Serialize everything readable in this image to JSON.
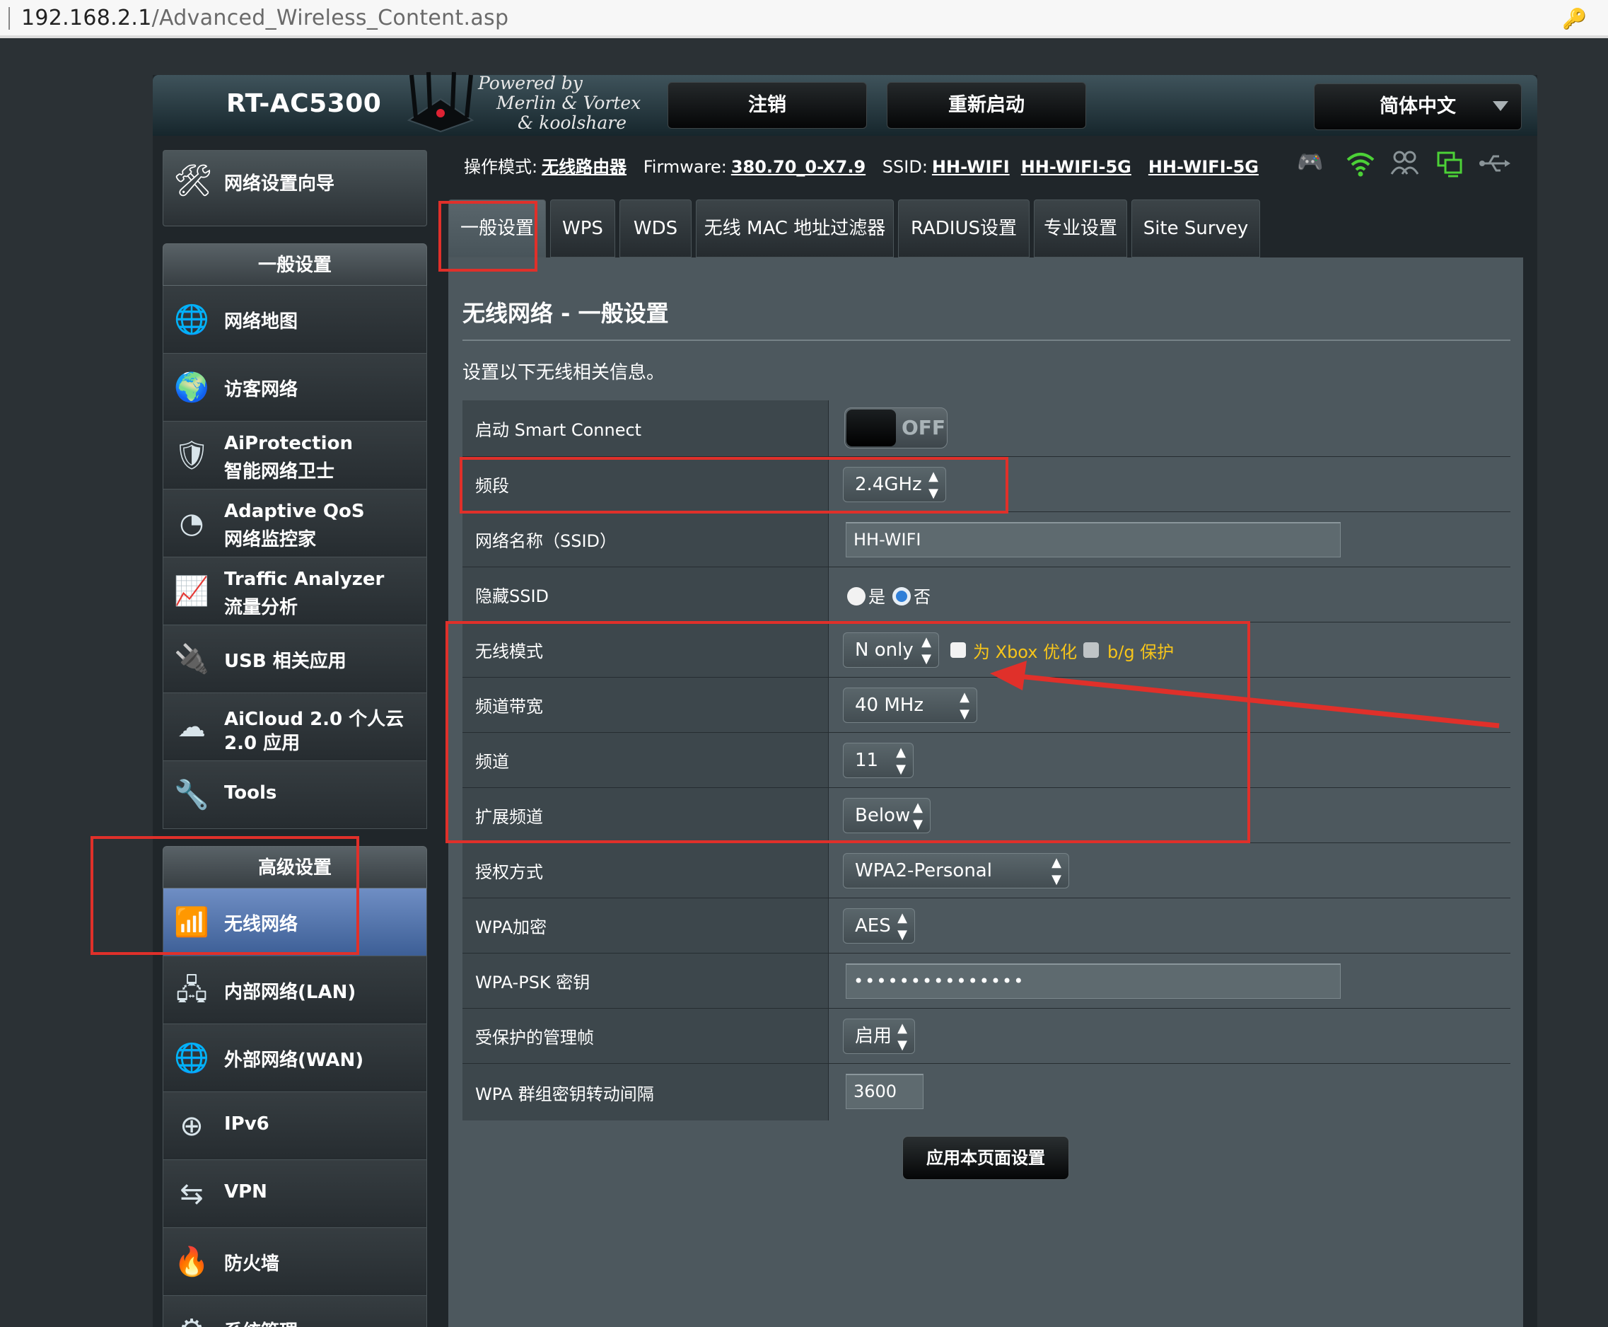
{
  "browser": {
    "url_host": "192.168.2.1",
    "url_path": "/Advanced_Wireless_Content.asp",
    "key_icon": "key-icon"
  },
  "header": {
    "model": "RT-AC5300",
    "powered": [
      "Powered by",
      "Merlin & Vortex",
      "& koolshare"
    ],
    "logout": "注销",
    "reboot": "重新启动",
    "language": "简体中文"
  },
  "status": {
    "mode_label": "操作模式:",
    "mode": "无线路由器",
    "fw_label": "Firmware:",
    "fw": "380.70_0-X7.9",
    "ssid_label": "SSID:",
    "ssid1": "HH-WIFI",
    "ssid2": "HH-WIFI-5G",
    "ssid3": "HH-WIFI-5G",
    "icons": [
      "gamepad-icon",
      "wifi-icon",
      "users-icon",
      "monitor-icon",
      "usb-icon"
    ],
    "icon_colors": [
      "#4cd137",
      "#4cd137",
      "#8a9498",
      "#4cd137",
      "#8a9498"
    ]
  },
  "sidebar": {
    "quick_setup": "网络设置向导",
    "general_header": "一般设置",
    "general": [
      {
        "l1": "网络地图",
        "l2": "",
        "icon": "globe-map-icon"
      },
      {
        "l1": "访客网络",
        "l2": "",
        "icon": "guest-network-icon"
      },
      {
        "l1": "AiProtection",
        "l2": "智能网络卫士",
        "icon": "shield-icon"
      },
      {
        "l1": "Adaptive QoS",
        "l2": "网络监控家",
        "icon": "gauge-icon"
      },
      {
        "l1": "Traffic Analyzer",
        "l2": "流量分析",
        "icon": "traffic-icon"
      },
      {
        "l1": "USB 相关应用",
        "l2": "",
        "icon": "usb-app-icon"
      },
      {
        "l1": "AiCloud 2.0 个人云",
        "l2": "2.0 应用",
        "icon": "cloud-icon"
      },
      {
        "l1": "Tools",
        "l2": "",
        "icon": "wrench-icon"
      }
    ],
    "advanced_header": "高级设置",
    "advanced": [
      {
        "l1": "无线网络",
        "icon": "wireless-icon"
      },
      {
        "l1": "内部网络(LAN)",
        "icon": "lan-icon"
      },
      {
        "l1": "外部网络(WAN)",
        "icon": "wan-globe-icon"
      },
      {
        "l1": "IPv6",
        "icon": "ipv6-icon"
      },
      {
        "l1": "VPN",
        "icon": "vpn-icon"
      },
      {
        "l1": "防火墙",
        "icon": "firewall-icon"
      },
      {
        "l1": "系统管理",
        "icon": "gear-icon"
      }
    ]
  },
  "tabs": [
    "一般设置",
    "WPS",
    "WDS",
    "无线 MAC 地址过滤器",
    "RADIUS设置",
    "专业设置",
    "Site Survey"
  ],
  "content": {
    "title": "无线网络 - 一般设置",
    "desc": "设置以下无线相关信息。",
    "rows": {
      "smart_connect": {
        "label": "启动 Smart Connect",
        "toggle": "OFF"
      },
      "band": {
        "label": "频段",
        "value": "2.4GHz"
      },
      "ssid": {
        "label": "网络名称（SSID）",
        "value": "HH-WIFI"
      },
      "hide_ssid": {
        "label": "隐藏SSID",
        "yes": "是",
        "no": "否"
      },
      "mode": {
        "label": "无线模式",
        "value": "N only",
        "xbox": "为 Xbox 优化",
        "bg": "b/g 保护"
      },
      "bandwidth": {
        "label": "频道带宽",
        "value": "40 MHz"
      },
      "channel": {
        "label": "频道",
        "value": "11"
      },
      "ext_channel": {
        "label": "扩展频道",
        "value": "Below"
      },
      "auth": {
        "label": "授权方式",
        "value": "WPA2-Personal"
      },
      "enc": {
        "label": "WPA加密",
        "value": "AES"
      },
      "psk": {
        "label": "WPA-PSK 密钥",
        "value": "•••••••••••••••"
      },
      "pmf": {
        "label": "受保护的管理帧",
        "value": "启用"
      },
      "rekey": {
        "label": "WPA 群组密钥转动间隔",
        "value": "3600"
      }
    },
    "apply": "应用本页面设置"
  }
}
